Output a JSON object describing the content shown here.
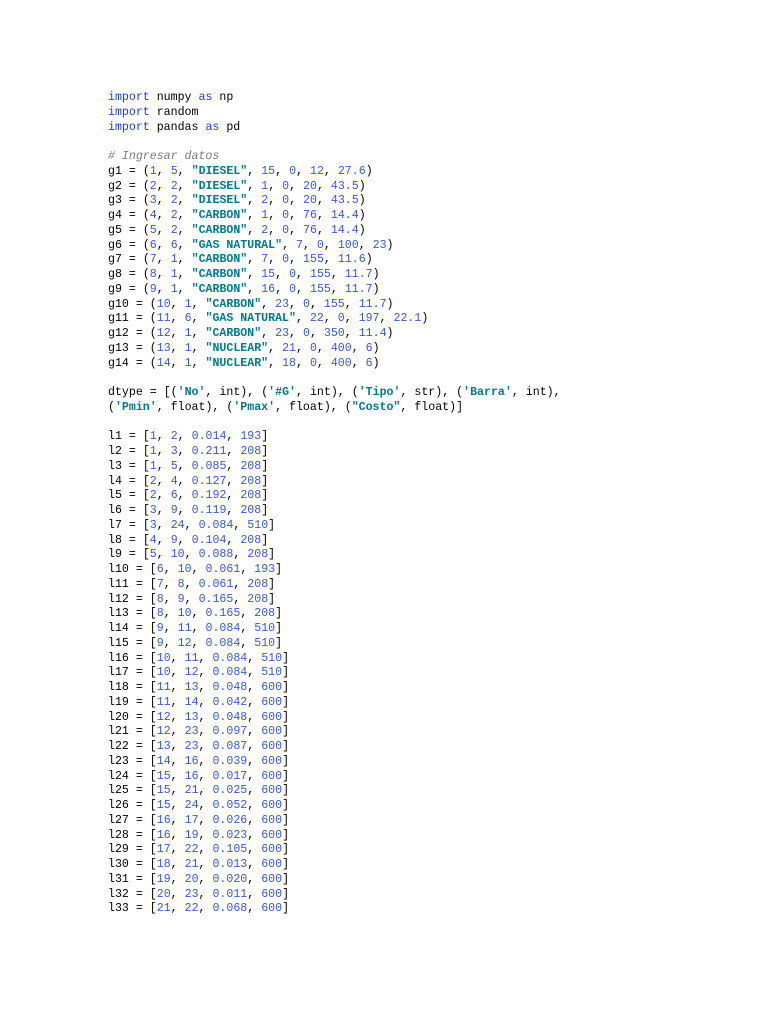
{
  "document": {
    "language": "python",
    "colors": {
      "keyword": "#1f3fc8",
      "number": "#3a58d0",
      "string": "#007a8a",
      "comment": "#7a7a7a",
      "text": "#000000"
    },
    "lines": [
      "import numpy as np",
      "import random",
      "import pandas as pd",
      "",
      "# Ingresar datos",
      "g1 = (1, 5, \"DIESEL\", 15, 0, 12, 27.6)",
      "g2 = (2, 2, \"DIESEL\", 1, 0, 20, 43.5)",
      "g3 = (3, 2, \"DIESEL\", 2, 0, 20, 43.5)",
      "g4 = (4, 2, \"CARBON\", 1, 0, 76, 14.4)",
      "g5 = (5, 2, \"CARBON\", 2, 0, 76, 14.4)",
      "g6 = (6, 6, \"GAS NATURAL\", 7, 0, 100, 23)",
      "g7 = (7, 1, \"CARBON\", 7, 0, 155, 11.6)",
      "g8 = (8, 1, \"CARBON\", 15, 0, 155, 11.7)",
      "g9 = (9, 1, \"CARBON\", 16, 0, 155, 11.7)",
      "g10 = (10, 1, \"CARBON\", 23, 0, 155, 11.7)",
      "g11 = (11, 6, \"GAS NATURAL\", 22, 0, 197, 22.1)",
      "g12 = (12, 1, \"CARBON\", 23, 0, 350, 11.4)",
      "g13 = (13, 1, \"NUCLEAR\", 21, 0, 400, 6)",
      "g14 = (14, 1, \"NUCLEAR\", 18, 0, 400, 6)",
      "",
      "dtype = [('No', int), ('#G', int), ('Tipo', str), ('Barra', int),",
      "('Pmin', float), ('Pmax', float), (\"Costo\", float)]",
      "",
      "l1 = [1, 2, 0.014, 193]",
      "l2 = [1, 3, 0.211, 208]",
      "l3 = [1, 5, 0.085, 208]",
      "l4 = [2, 4, 0.127, 208]",
      "l5 = [2, 6, 0.192, 208]",
      "l6 = [3, 9, 0.119, 208]",
      "l7 = [3, 24, 0.084, 510]",
      "l8 = [4, 9, 0.104, 208]",
      "l9 = [5, 10, 0.088, 208]",
      "l10 = [6, 10, 0.061, 193]",
      "l11 = [7, 8, 0.061, 208]",
      "l12 = [8, 9, 0.165, 208]",
      "l13 = [8, 10, 0.165, 208]",
      "l14 = [9, 11, 0.084, 510]",
      "l15 = [9, 12, 0.084, 510]",
      "l16 = [10, 11, 0.084, 510]",
      "l17 = [10, 12, 0.084, 510]",
      "l18 = [11, 13, 0.048, 600]",
      "l19 = [11, 14, 0.042, 600]",
      "l20 = [12, 13, 0.048, 600]",
      "l21 = [12, 23, 0.097, 600]",
      "l22 = [13, 23, 0.087, 600]",
      "l23 = [14, 16, 0.039, 600]",
      "l24 = [15, 16, 0.017, 600]",
      "l25 = [15, 21, 0.025, 600]",
      "l26 = [15, 24, 0.052, 600]",
      "l27 = [16, 17, 0.026, 600]",
      "l28 = [16, 19, 0.023, 600]",
      "l29 = [17, 22, 0.105, 600]",
      "l30 = [18, 21, 0.013, 600]",
      "l31 = [19, 20, 0.020, 600]",
      "l32 = [20, 23, 0.011, 600]",
      "l33 = [21, 22, 0.068, 600]"
    ]
  }
}
